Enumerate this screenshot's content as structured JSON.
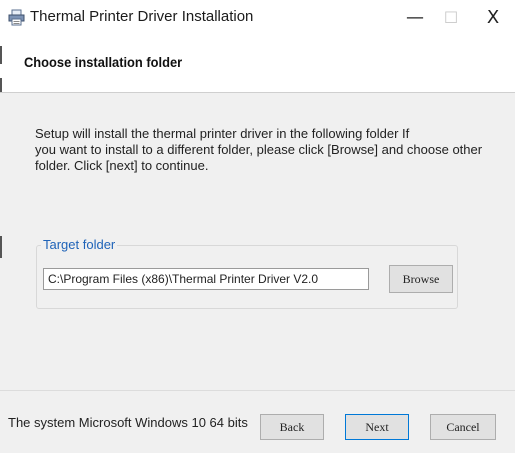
{
  "window": {
    "title": "Thermal Printer Driver Installation",
    "icon": "printer-icon",
    "minimize_glyph": "—",
    "maximize_glyph": "☐",
    "close_glyph": "X"
  },
  "header": {
    "title": "Choose installation folder"
  },
  "body": {
    "intro_lines": [
      "Setup will install the thermal printer driver in the following folder If",
      "you want to install to a different folder, please click [Browse] and choose other",
      "folder. Click [next] to continue."
    ]
  },
  "target": {
    "legend": "Target folder",
    "path_value": "C:\\Program Files (x86)\\Thermal Printer Driver V2.0",
    "browse_label": "Browse"
  },
  "footer": {
    "status": "The system Microsoft Windows 10 64 bits",
    "back_label": "Back",
    "next_label": "Next",
    "cancel_label": "Cancel"
  },
  "colors": {
    "accent": "#0078d7",
    "legend": "#1f63b8",
    "panel": "#f0f0f0"
  }
}
